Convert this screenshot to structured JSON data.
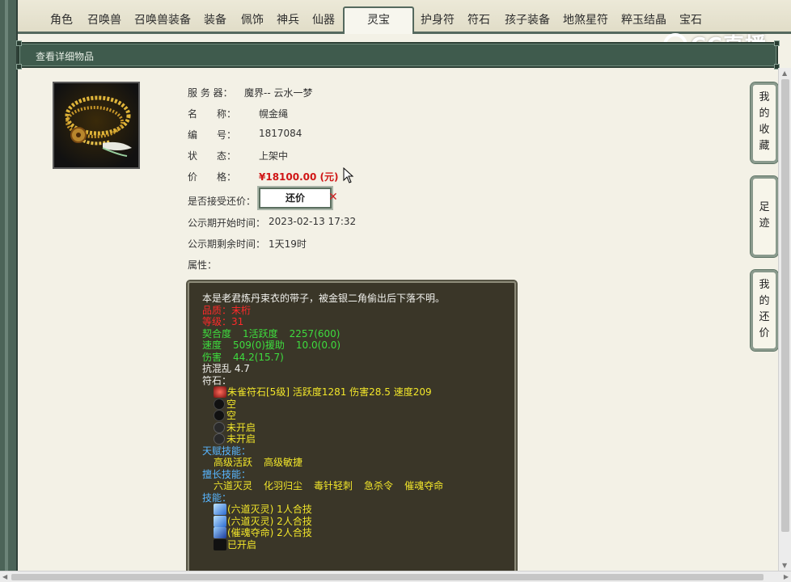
{
  "tabs": [
    {
      "label": "角色"
    },
    {
      "label": "召唤兽"
    },
    {
      "label": "召唤兽装备"
    },
    {
      "label": "装备"
    },
    {
      "label": "佩饰"
    },
    {
      "label": "神兵"
    },
    {
      "label": "仙器"
    },
    {
      "label": "灵宝",
      "active": true
    },
    {
      "label": "护身符"
    },
    {
      "label": "符石"
    },
    {
      "label": "孩子装备"
    },
    {
      "label": "地煞星符"
    },
    {
      "label": "粹玉结晶"
    },
    {
      "label": "宝石"
    }
  ],
  "watermark": "CC直播",
  "header": {
    "title": "查看详细物品"
  },
  "item": {
    "rows": [
      {
        "label": "服 务 器：",
        "value": "魔界-- 云水一梦"
      },
      {
        "label": "名　　称：",
        "value": "幌金绳"
      },
      {
        "label": "编　　号：",
        "value": "1817084"
      },
      {
        "label": "状　　态：",
        "value": "上架中"
      },
      {
        "label": "价　　格：",
        "value": "¥18100.00 (元)"
      }
    ],
    "haggle_label": "是否接受还价：",
    "haggle_button": "还价",
    "haggle_x": "✕",
    "start_label": "公示期开始时间：",
    "start_value": "2023-02-13 17:32",
    "remain_label": "公示期剩余时间：",
    "remain_value": "1天19时",
    "attr_label": "属性："
  },
  "detail": {
    "desc": "本是老君炼丹束衣的带子，被金银二角偷出后下落不明。",
    "quality": "品质：末桁",
    "level": "等级：31",
    "stat1_a": "契合度",
    "stat1_b": "1活跃度",
    "stat1_c": "2257(600)",
    "stat2_a": "速度",
    "stat2_b": "509(0)援助",
    "stat2_c": "10.0(0.0)",
    "stat3_a": "伤害",
    "stat3_b": "44.2(15.7)",
    "stat4": "抗混乱 4.7",
    "rune_title": "符石：",
    "runes": [
      {
        "text": "朱雀符石[5级] 活跃度1281 伤害28.5 速度209",
        "icon": "rune-icon",
        "color": "#c0392b"
      },
      {
        "text": "空",
        "icon": "empty-slot-icon",
        "color": "#222"
      },
      {
        "text": "空",
        "icon": "empty-slot-icon",
        "color": "#222"
      },
      {
        "text": "未开启",
        "icon": "locked-slot-icon",
        "color": "#3a3a3a"
      },
      {
        "text": "未开启",
        "icon": "locked-slot-icon",
        "color": "#3a3a3a"
      }
    ],
    "talent_title": "天赋技能：",
    "talents": [
      "高级活跃",
      "高级敏捷"
    ],
    "special_title": "擅长技能：",
    "specials": [
      "六道灭灵",
      "化羽归尘",
      "毒针轻刺",
      "急杀令",
      "催魂夺命"
    ],
    "skill_title": "技能：",
    "skills": [
      "(六道灭灵) 1人合技",
      "(六道灭灵) 2人合技",
      "(催魂夺命) 2人合技",
      "已开启"
    ]
  },
  "side": {
    "collect": [
      "我",
      "的",
      "收",
      "藏"
    ],
    "trace": [
      "足",
      "迹"
    ],
    "haggles": [
      "我",
      "的",
      "还",
      "价"
    ]
  }
}
